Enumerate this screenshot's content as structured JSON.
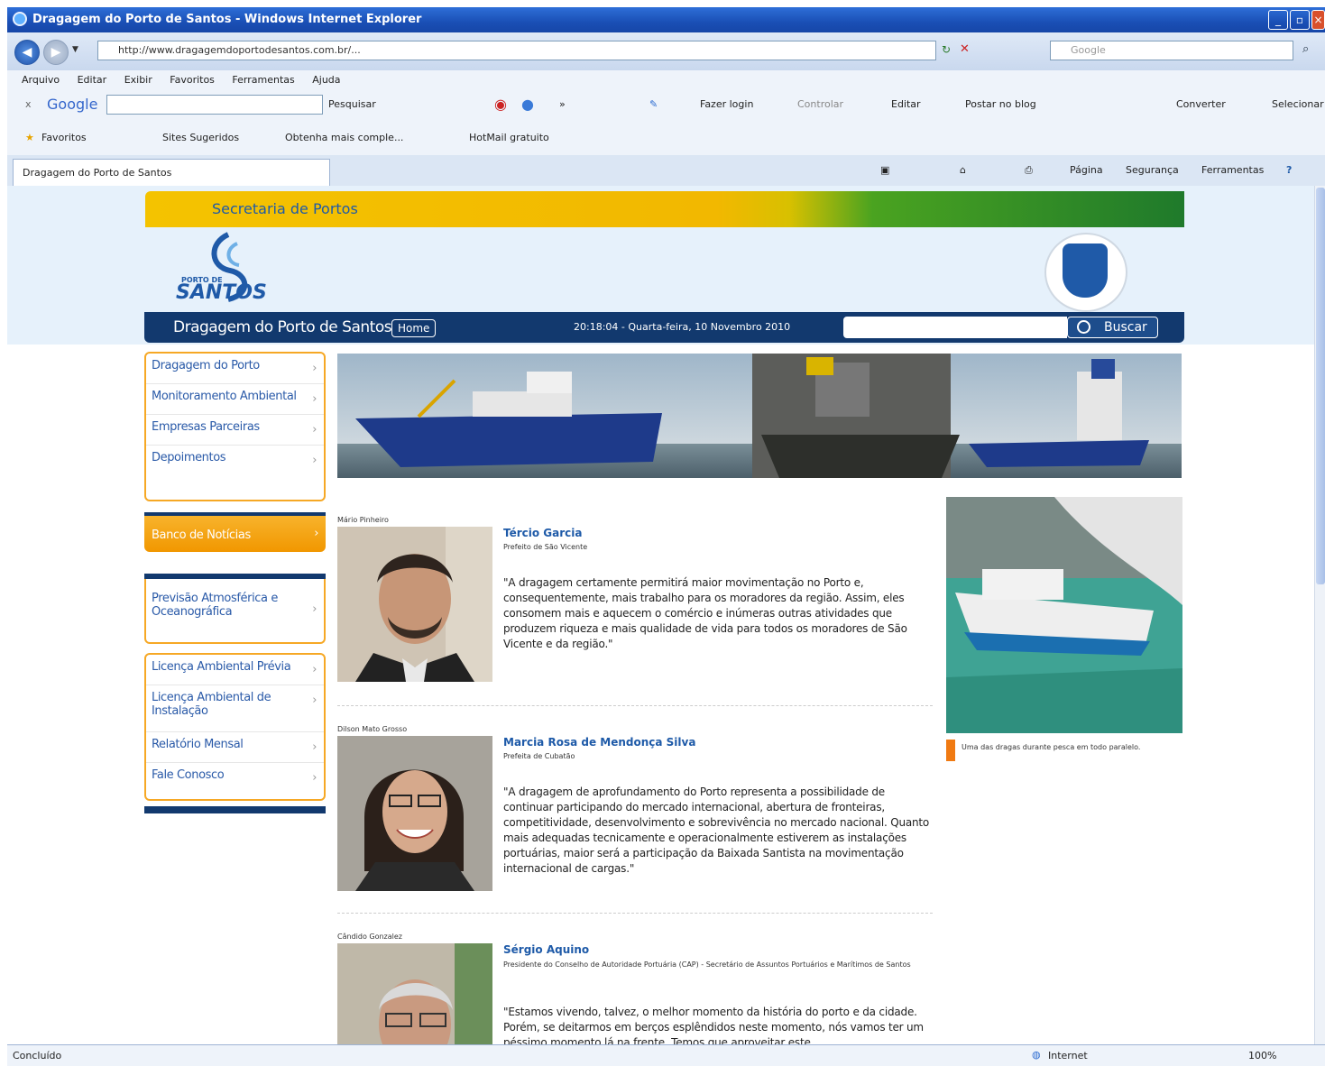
{
  "window": {
    "title": "Dragagem do Porto de Santos - Windows Internet Explorer",
    "url": "http://www.dragagemdoportodesantos.com.br/...",
    "search_placeholder": "Google"
  },
  "menu": [
    "Arquivo",
    "Editar",
    "Exibir",
    "Favoritos",
    "Ferramentas",
    "Ajuda"
  ],
  "google_toolbar": {
    "logo": "Google",
    "search_label": "Pesquisar",
    "signin_label": "Fazer login",
    "translate_label": "Controlar",
    "edit_label": "Editar",
    "blog_label": "Postar no blog",
    "convert_label": "Converter",
    "select_label": "Selecionar"
  },
  "favorites_bar": {
    "favorites_label": "Favoritos",
    "items": [
      "Sites Sugeridos",
      "Obtenha mais comple...",
      "HotMail gratuito"
    ]
  },
  "tab": {
    "label": "Dragagem do Porto de Santos"
  },
  "command_bar": {
    "page_label": "Página",
    "security_label": "Segurança",
    "tools_label": "Ferramentas"
  },
  "status": {
    "left": "Concluído",
    "zone": "Internet",
    "zoom": "100%"
  },
  "site": {
    "banner_text": "Secretaria de Portos",
    "logo_line1": "PORTO DE",
    "logo_line2": "SANTOS",
    "name": "Dragagem do Porto de Santos",
    "home_label": "Home",
    "datetime": "20:18:04 - Quarta-feira, 10 Novembro 2010",
    "search_button": "Buscar"
  },
  "sidebar": {
    "group1": [
      "Dragagem do Porto",
      "Monitoramento Ambiental",
      "Empresas Parceiras",
      "Depoimentos"
    ],
    "news_label": "Banco de Notícias",
    "forecast_label": "Previsão Atmosférica e Oceanográfica",
    "group3": [
      "Licença Ambiental Prévia",
      "Licença Ambiental de Instalação",
      "Relatório Mensal",
      "Fale Conosco"
    ]
  },
  "testimonials": [
    {
      "photo_credit": "Mário Pinheiro",
      "name": "Tércio Garcia",
      "role": "Prefeito de São Vicente",
      "quote": "\"A dragagem certamente permitirá maior movimentação no Porto e, consequentemente, mais trabalho para os moradores da região. Assim, eles consomem mais e aquecem o comércio e inúmeras outras atividades que produzem riqueza e mais qualidade de vida para todos os moradores de São Vicente e da região.\""
    },
    {
      "photo_credit": "Dilson Mato Grosso",
      "name": "Marcia Rosa de Mendonça Silva",
      "role": "Prefeita de Cubatão",
      "quote": "\"A dragagem de aprofundamento do Porto representa a possibilidade de continuar participando do mercado internacional, abertura de fronteiras, competitividade, desenvolvimento e sobrevivência no mercado nacional. Quanto mais adequadas tecnicamente e operacionalmente estiverem as instalações portuárias, maior será a participação da Baixada Santista na movimentação internacional de cargas.\""
    },
    {
      "photo_credit": "Cândido Gonzalez",
      "name": "Sérgio Aquino",
      "role": "Presidente do Conselho de Autoridade Portuária (CAP) - Secretário de Assuntos Portuários e Marítimos de Santos",
      "quote": "\"Estamos vivendo, talvez, o melhor momento da história do porto e da cidade. Porém, se deitarmos em berços esplêndidos neste momento, nós vamos ter um péssimo momento lá na frente. Temos que aproveitar este"
    }
  ],
  "side_photo_caption": "Uma das dragas durante pesca em todo paralelo.",
  "colors": {
    "navy": "#12396e",
    "orange": "#f6a825",
    "link_blue": "#2a5aa8"
  }
}
